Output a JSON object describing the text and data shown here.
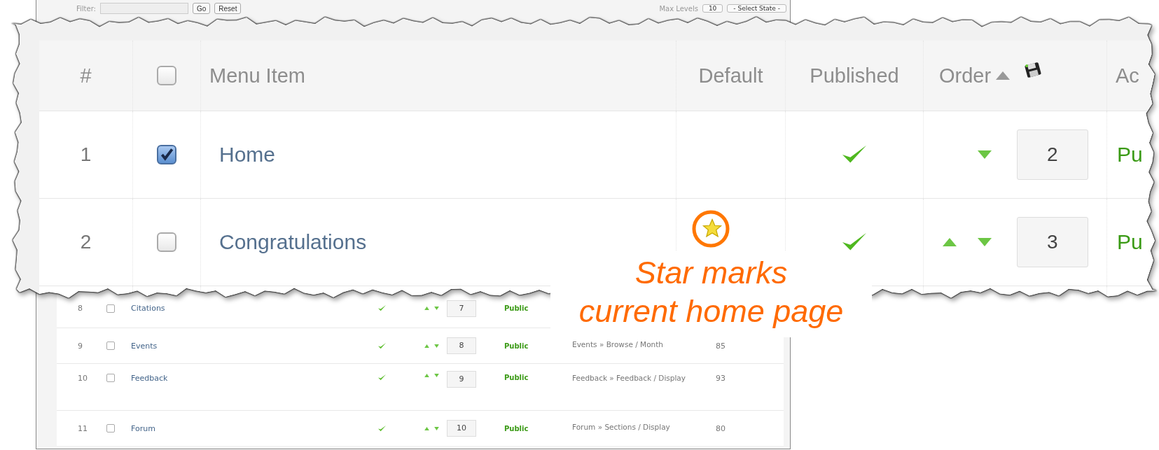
{
  "background_page": {
    "filter": {
      "label": "Filter:",
      "go": "Go",
      "reset": "Reset"
    },
    "max_levels": {
      "label": "Max Levels",
      "value": "10"
    },
    "state_select": {
      "value": "- Select State -"
    },
    "rows": [
      {
        "number": "8",
        "checked": false,
        "title": "Citations",
        "published": true,
        "move_up": true,
        "move_down": true,
        "order": "7",
        "access": "Public"
      },
      {
        "number": "9",
        "checked": false,
        "title": "Events",
        "published": true,
        "move_up": true,
        "move_down": true,
        "order": "8",
        "access": "Public",
        "link": "Events » Browse / Month",
        "id": "85"
      },
      {
        "number": "10",
        "checked": false,
        "title": "Feedback",
        "published": true,
        "move_up": true,
        "move_down": true,
        "order": "9",
        "access": "Public",
        "link": "Feedback » Feedback / Display",
        "id": "93"
      },
      {
        "number": "11",
        "checked": false,
        "title": "Forum",
        "published": true,
        "move_up": true,
        "move_down": true,
        "order": "10",
        "access": "Public",
        "link": "Forum » Sections / Display",
        "id": "80"
      }
    ]
  },
  "zoomed_view": {
    "header": {
      "number": "#",
      "all_checked": false,
      "title": "Menu Item",
      "default": "Default",
      "published": "Published",
      "order": "Order",
      "access": "Ac"
    },
    "rows": [
      {
        "number": "1",
        "checked": true,
        "title": "Home",
        "default": false,
        "published": true,
        "move_up": false,
        "move_down": true,
        "order": "2",
        "access": "Pu"
      },
      {
        "number": "2",
        "checked": false,
        "title": "Congratulations",
        "default": true,
        "published": true,
        "move_up": true,
        "move_down": true,
        "order": "3",
        "access": "Pu"
      }
    ]
  },
  "callout": {
    "lines": [
      "Star marks",
      "current home page"
    ]
  }
}
